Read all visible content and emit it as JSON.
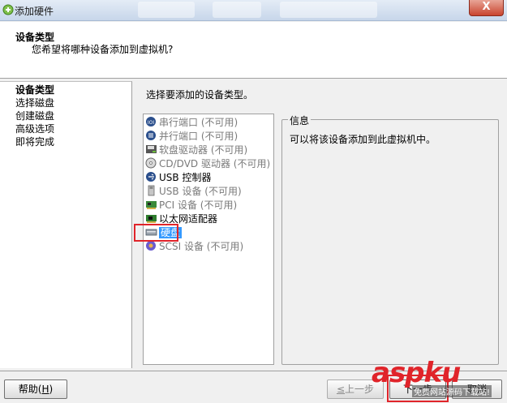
{
  "window": {
    "title": "添加硬件",
    "close_glyph": "X"
  },
  "header": {
    "title": "设备类型",
    "subtitle": "您希望将哪种设备添加到虚拟机?"
  },
  "steps": [
    {
      "label": "设备类型"
    },
    {
      "label": "选择磁盘"
    },
    {
      "label": "创建磁盘"
    },
    {
      "label": "高级选项"
    },
    {
      "label": "即将完成"
    }
  ],
  "prompt": "选择要添加的设备类型。",
  "devices": [
    {
      "label": "串行端口 (不可用)",
      "icon": "serial-port-icon"
    },
    {
      "label": "并行端口 (不可用)",
      "icon": "parallel-port-icon"
    },
    {
      "label": "软盘驱动器 (不可用)",
      "icon": "floppy-drive-icon"
    },
    {
      "label": "CD/DVD 驱动器 (不可用)",
      "icon": "cd-dvd-icon"
    },
    {
      "label": "USB 控制器",
      "icon": "usb-controller-icon"
    },
    {
      "label": "USB 设备 (不可用)",
      "icon": "usb-device-icon"
    },
    {
      "label": "PCI 设备 (不可用)",
      "icon": "pci-device-icon"
    },
    {
      "label": "以太网适配器",
      "icon": "ethernet-adapter-icon"
    },
    {
      "label": "硬盘",
      "icon": "hard-disk-icon"
    },
    {
      "label": "SCSI 设备 (不可用)",
      "icon": "scsi-device-icon"
    }
  ],
  "info": {
    "legend": "信息",
    "text": "可以将该设备添加到此虚拟机中。"
  },
  "footer": {
    "help_label": "帮助(",
    "help_accel": "H",
    "help_close": ")",
    "back_accel": "≤",
    "back_label": "上一步",
    "next_label": "下一步",
    "cancel_label": "取消"
  },
  "watermark": {
    "main": "aspku",
    "sub": "免费网站源码下载站!"
  },
  "colors": {
    "highlight_red": "#e0242a",
    "selection_blue": "#3399ff"
  }
}
